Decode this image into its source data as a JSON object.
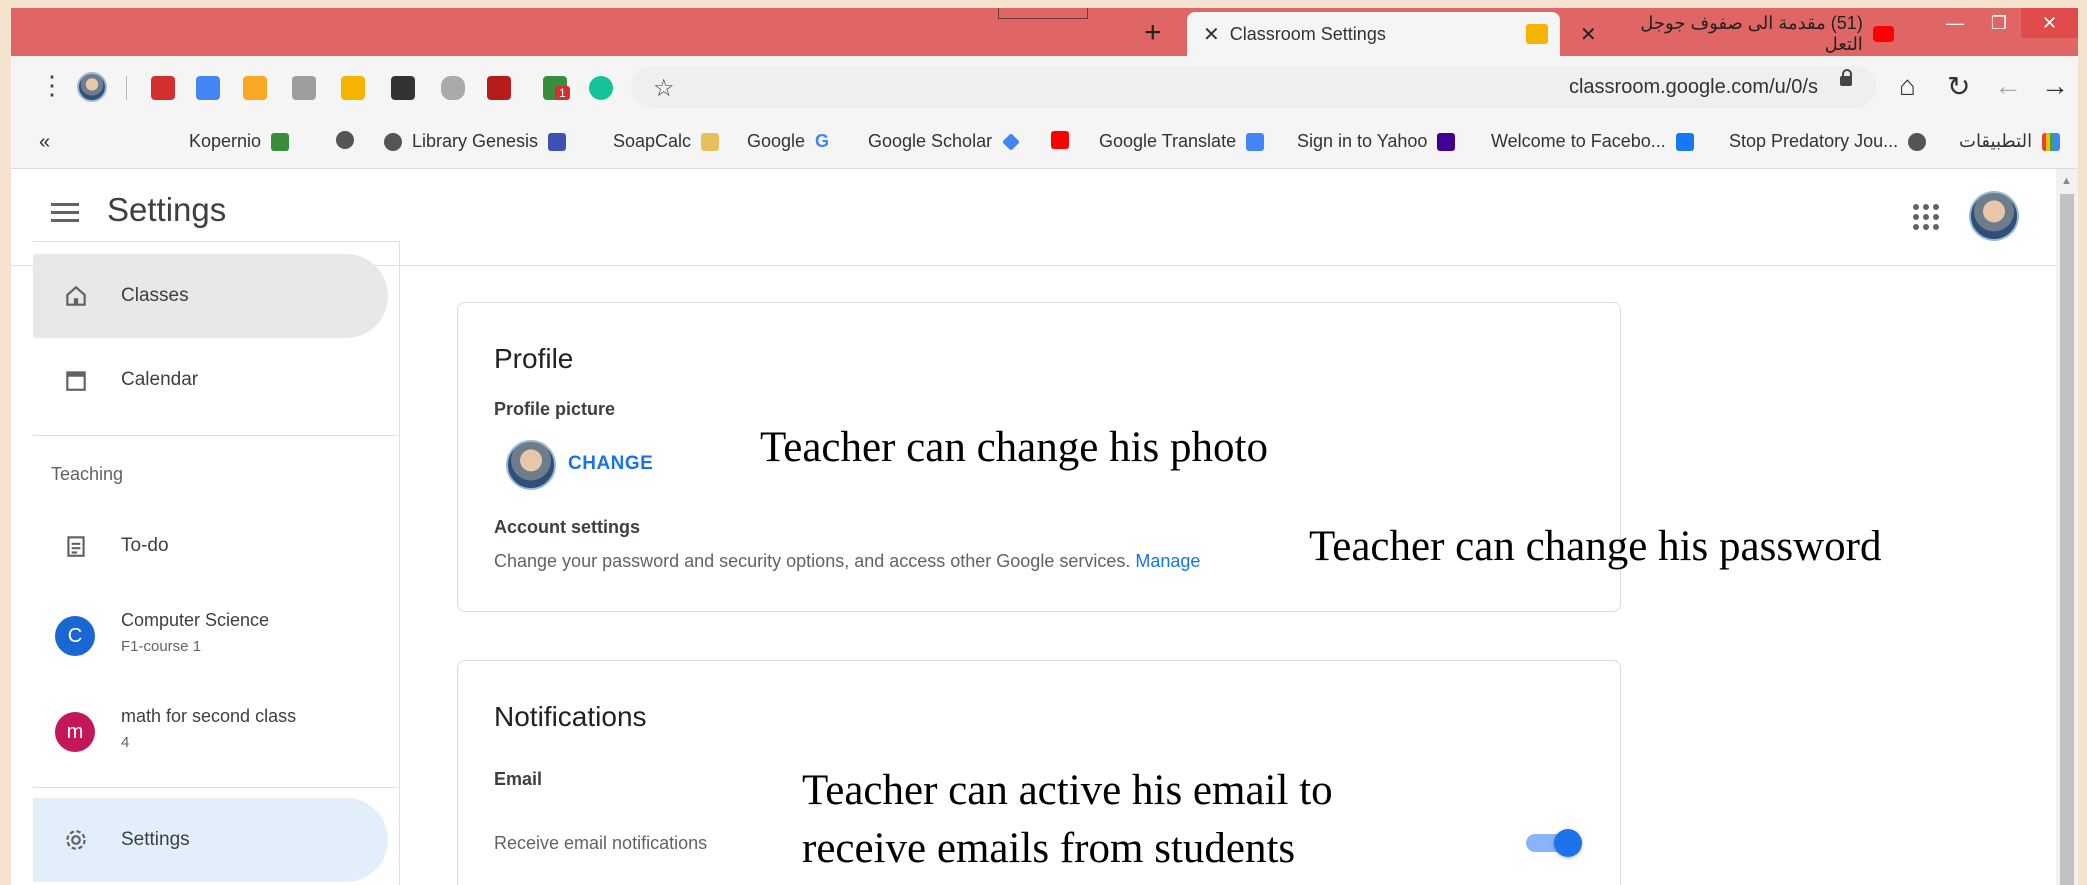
{
  "browser": {
    "tabs": [
      {
        "label": "Classroom Settings",
        "active": true
      },
      {
        "label": "(51) مقدمة الى صفوف جوجل التعل",
        "active": false
      }
    ],
    "new_tab": "+",
    "close": "✕",
    "url": "classroom.google.com/u/0/s",
    "extension_badge": "1",
    "bookmarks": [
      "Kopernio",
      "Library Genesis",
      "SoapCalc",
      "Google",
      "Google Scholar",
      "Google Translate",
      "Sign in to Yahoo",
      "Welcome to Facebo...",
      "Stop Predatory Jou...",
      "التطبيقات"
    ],
    "bookmarks_more": "«"
  },
  "app": {
    "title": "Settings"
  },
  "sidebar": {
    "items": [
      {
        "label": "Classes"
      },
      {
        "label": "Calendar"
      }
    ],
    "section_heading": "Teaching",
    "todo_label": "To-do",
    "courses": [
      {
        "initial": "C",
        "name": "Computer Science",
        "section": "F1-course 1",
        "color": "#1967d2"
      },
      {
        "initial": "m",
        "name": "math for second class",
        "section": "4",
        "color": "#c2185b"
      }
    ],
    "settings_label": "Settings"
  },
  "profile": {
    "title": "Profile",
    "picture_label": "Profile picture",
    "change_label": "CHANGE",
    "account_label": "Account settings",
    "account_text": "Change your password and security options, and access other Google services.",
    "manage_label": "Manage"
  },
  "notifications": {
    "title": "Notifications",
    "email_label": "Email",
    "receive_text": "Receive email notifications",
    "toggle_on": true
  },
  "annotations": {
    "photo": "Teacher can change his photo",
    "password": "Teacher can change his password",
    "email_line1": "Teacher can active his email  to",
    "email_line2": "receive emails from students"
  },
  "colors": {
    "tab_strip": "#e06666",
    "accent": "#1a73e8",
    "slide_bg": "#f4e3cf"
  }
}
